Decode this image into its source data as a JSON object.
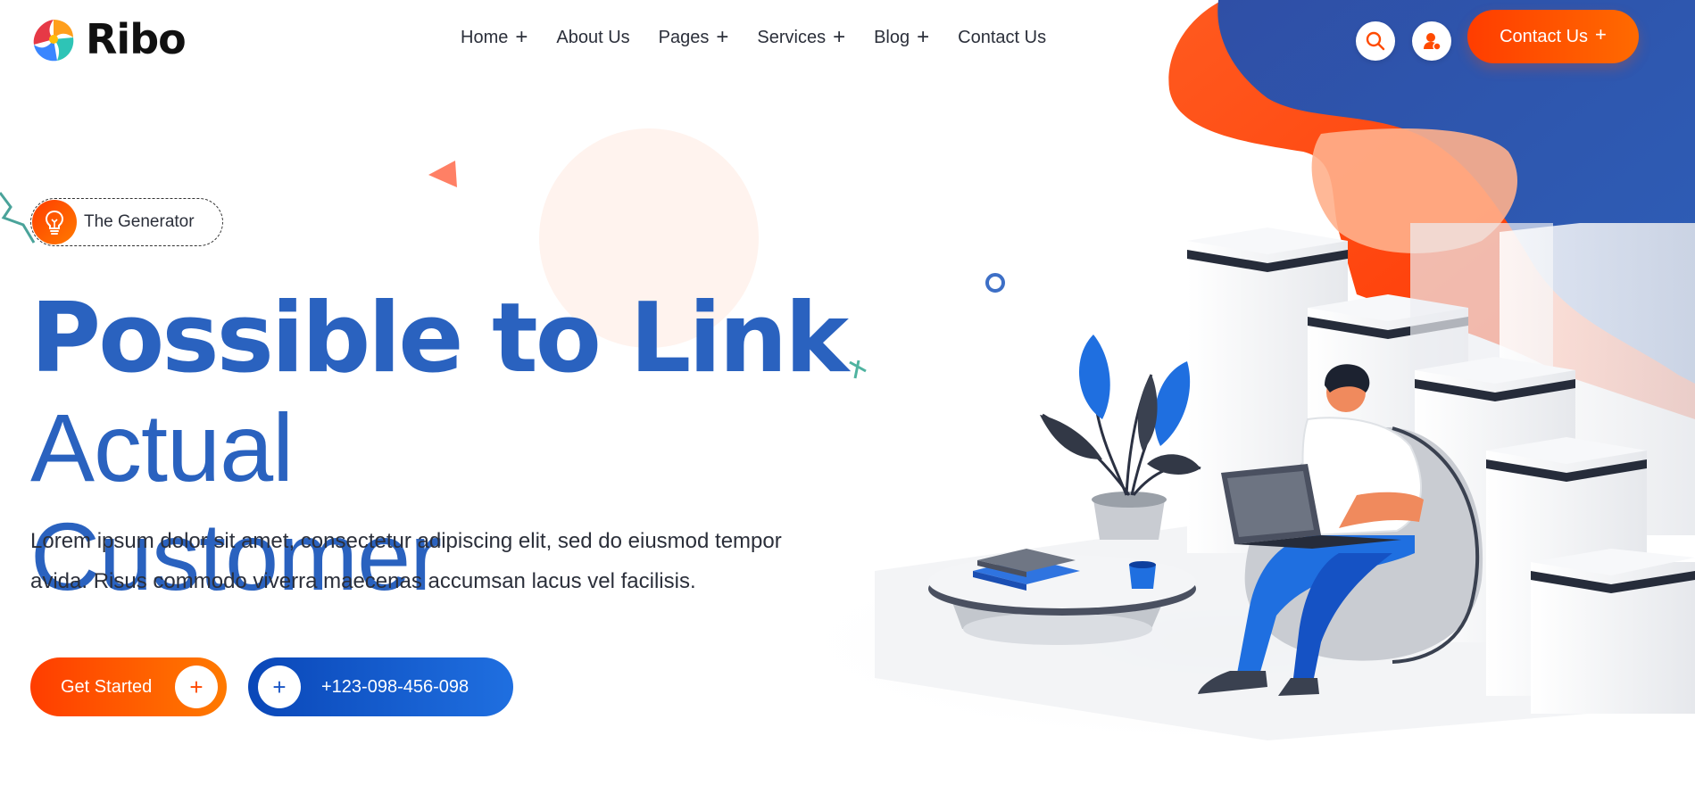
{
  "brand": {
    "name": "Ribo"
  },
  "nav": {
    "items": [
      {
        "label": "Home",
        "has_submenu": true
      },
      {
        "label": "About Us",
        "has_submenu": false
      },
      {
        "label": "Pages",
        "has_submenu": true
      },
      {
        "label": "Services",
        "has_submenu": true
      },
      {
        "label": "Blog",
        "has_submenu": true
      },
      {
        "label": "Contact Us",
        "has_submenu": false
      }
    ],
    "submenu_glyph": "+"
  },
  "header": {
    "search_icon": "search-icon",
    "user_icon": "user-icon",
    "cta_label": "Contact Us",
    "cta_glyph": "+"
  },
  "hero": {
    "badge_icon": "lightbulb-icon",
    "badge_label": "The Generator",
    "title_strong": "Possible to Link",
    "title_light_1": "Actual",
    "title_light_2": "Customer",
    "description_line_1": "Lorem ipsum dolor sit amet, consectetur adipiscing elit, sed do eiusmod tempor",
    "description_line_2": "avida. Risus commodo viverra maecenas accumsan lacus vel facilisis.",
    "primary_button_label": "Get Started",
    "primary_button_glyph": "+",
    "phone_button_label": "+123-098-456-098",
    "phone_button_glyph": "+"
  },
  "colors": {
    "brand_blue": "#2a62bf",
    "accent_orange": "#ff4a00",
    "deep_blue": "#2b5aa8"
  }
}
